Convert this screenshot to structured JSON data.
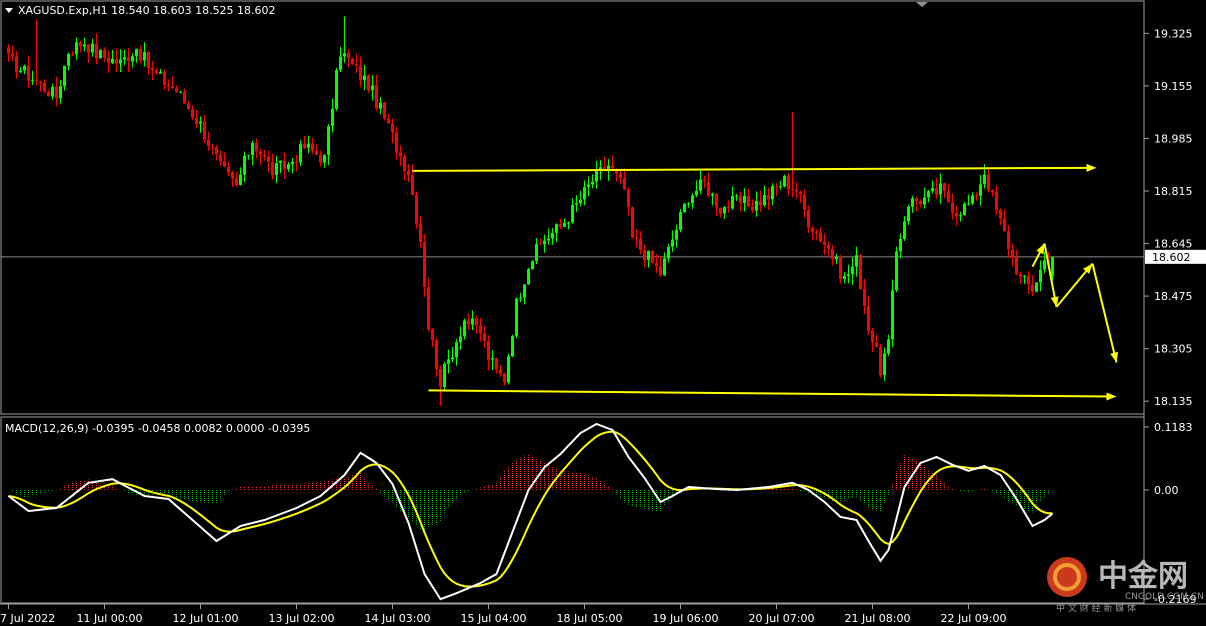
{
  "window": {
    "symbol_header": "XAGUSD.Exp,H1  18.540 18.603 18.525 18.602",
    "macd_header": "MACD(12,26,9) -0.0395 -0.0458 0.0082 0.0000 -0.0395"
  },
  "watermark": {
    "brand_cn": "中金网",
    "brand_url": "CNGOLD.COM.CN",
    "tagline_cn": "中 文 财 经 新 媒 体"
  },
  "colors": {
    "background": "#000000",
    "bull": "#00ff00",
    "bear": "#ff0000",
    "annotation": "#ffff00",
    "macd_line": "#ffffff",
    "signal_line": "#ffff00",
    "hist_pos": "#ff2a2a",
    "hist_neg": "#00b400"
  },
  "chart_data": [
    {
      "type": "candlestick",
      "symbol": "XAGUSD.Exp",
      "timeframe": "H1",
      "ohlc_last": {
        "open": 18.54,
        "high": 18.603,
        "low": 18.525,
        "close": 18.602
      },
      "ylim": [
        18.1,
        19.42
      ],
      "y_ticks": [
        19.325,
        19.155,
        18.985,
        18.815,
        18.645,
        18.475,
        18.305,
        18.135
      ],
      "y_tick_labels": [
        "19.325",
        "19.155",
        "18.985",
        "18.815",
        "18.645",
        "18.475",
        "18.305",
        "18.135"
      ],
      "current_price": 18.602,
      "current_price_label": "18.602",
      "x_labels": [
        "7 Jul 2022",
        "11 Jul 00:00",
        "12 Jul 01:00",
        "13 Jul 02:00",
        "14 Jul 03:00",
        "15 Jul 04:00",
        "18 Jul 05:00",
        "19 Jul 06:00",
        "20 Jul 07:00",
        "21 Jul 08:00",
        "22 Jul 09:00"
      ],
      "x_label_bar_index": [
        0,
        24,
        48,
        72,
        96,
        120,
        144,
        168,
        192,
        216,
        240
      ],
      "bar_count": 262,
      "anchors_close": [
        [
          0,
          19.24
        ],
        [
          6,
          19.18
        ],
        [
          12,
          19.12
        ],
        [
          15,
          19.27
        ],
        [
          19,
          19.3
        ],
        [
          22,
          19.26
        ],
        [
          28,
          19.23
        ],
        [
          32,
          19.28
        ],
        [
          36,
          19.2
        ],
        [
          42,
          19.14
        ],
        [
          48,
          19.03
        ],
        [
          53,
          18.89
        ],
        [
          57,
          18.83
        ],
        [
          61,
          18.98
        ],
        [
          66,
          18.88
        ],
        [
          70,
          18.9
        ],
        [
          74,
          18.96
        ],
        [
          79,
          18.92
        ],
        [
          83,
          19.27
        ],
        [
          86,
          19.22
        ],
        [
          90,
          19.16
        ],
        [
          94,
          19.05
        ],
        [
          98,
          18.93
        ],
        [
          100,
          18.88
        ],
        [
          103,
          18.66
        ],
        [
          105,
          18.38
        ],
        [
          108,
          18.2
        ],
        [
          111,
          18.3
        ],
        [
          114,
          18.4
        ],
        [
          118,
          18.36
        ],
        [
          120,
          18.28
        ],
        [
          122,
          18.23
        ],
        [
          124,
          18.21
        ],
        [
          127,
          18.45
        ],
        [
          130,
          18.58
        ],
        [
          134,
          18.66
        ],
        [
          138,
          18.7
        ],
        [
          142,
          18.77
        ],
        [
          146,
          18.85
        ],
        [
          150,
          18.9
        ],
        [
          154,
          18.82
        ],
        [
          156,
          18.66
        ],
        [
          160,
          18.6
        ],
        [
          163,
          18.55
        ],
        [
          166,
          18.66
        ],
        [
          170,
          18.8
        ],
        [
          174,
          18.84
        ],
        [
          178,
          18.76
        ],
        [
          182,
          18.78
        ],
        [
          186,
          18.77
        ],
        [
          190,
          18.8
        ],
        [
          194,
          18.85
        ],
        [
          197,
          18.82
        ],
        [
          200,
          18.72
        ],
        [
          205,
          18.63
        ],
        [
          209,
          18.53
        ],
        [
          212,
          18.59
        ],
        [
          215,
          18.38
        ],
        [
          218,
          18.24
        ],
        [
          220,
          18.32
        ],
        [
          222,
          18.62
        ],
        [
          225,
          18.78
        ],
        [
          229,
          18.79
        ],
        [
          233,
          18.82
        ],
        [
          237,
          18.75
        ],
        [
          241,
          18.78
        ],
        [
          244,
          18.88
        ],
        [
          247,
          18.75
        ],
        [
          250,
          18.64
        ],
        [
          253,
          18.53
        ],
        [
          256,
          18.5
        ],
        [
          259,
          18.59
        ],
        [
          261,
          18.602
        ]
      ],
      "annotations": {
        "resistance_line": {
          "from": [
            101,
            18.88
          ],
          "to": [
            272,
            18.89
          ]
        },
        "support_line": {
          "from": [
            105,
            18.17
          ],
          "to": [
            277,
            18.15
          ]
        },
        "projection_path": [
          [
            256,
            18.57
          ],
          [
            259,
            18.645
          ],
          [
            262,
            18.44
          ],
          [
            271,
            18.58
          ],
          [
            277,
            18.26
          ]
        ]
      }
    },
    {
      "type": "macd",
      "title": "MACD(12,26,9)",
      "values_shown": [
        -0.0395,
        -0.0458,
        0.0082,
        0.0,
        -0.0395
      ],
      "ylim": [
        -0.185,
        0.1183
      ],
      "y_ticks": [
        0.1183,
        0.0,
        -0.2169
      ],
      "y_tick_labels": [
        "0.1183",
        "0.00",
        "-0.2169"
      ],
      "anchors_macd": [
        [
          0,
          -0.01
        ],
        [
          5,
          -0.035
        ],
        [
          12,
          -0.03
        ],
        [
          20,
          0.012
        ],
        [
          26,
          0.018
        ],
        [
          34,
          -0.01
        ],
        [
          40,
          -0.015
        ],
        [
          46,
          -0.05
        ],
        [
          52,
          -0.085
        ],
        [
          58,
          -0.06
        ],
        [
          64,
          -0.05
        ],
        [
          72,
          -0.03
        ],
        [
          78,
          -0.01
        ],
        [
          84,
          0.025
        ],
        [
          88,
          0.062
        ],
        [
          92,
          0.045
        ],
        [
          96,
          0.01
        ],
        [
          100,
          -0.055
        ],
        [
          104,
          -0.14
        ],
        [
          108,
          -0.182
        ],
        [
          112,
          -0.172
        ],
        [
          118,
          -0.155
        ],
        [
          122,
          -0.14
        ],
        [
          126,
          -0.07
        ],
        [
          130,
          0.0
        ],
        [
          134,
          0.038
        ],
        [
          138,
          0.06
        ],
        [
          143,
          0.095
        ],
        [
          147,
          0.11
        ],
        [
          151,
          0.1
        ],
        [
          155,
          0.055
        ],
        [
          159,
          0.02
        ],
        [
          163,
          -0.02
        ],
        [
          166,
          -0.01
        ],
        [
          170,
          0.005
        ],
        [
          176,
          0.002
        ],
        [
          182,
          0.0
        ],
        [
          190,
          0.005
        ],
        [
          196,
          0.012
        ],
        [
          200,
          0.0
        ],
        [
          204,
          -0.02
        ],
        [
          208,
          -0.045
        ],
        [
          212,
          -0.05
        ],
        [
          215,
          -0.085
        ],
        [
          218,
          -0.118
        ],
        [
          220,
          -0.1
        ],
        [
          224,
          0.005
        ],
        [
          228,
          0.045
        ],
        [
          232,
          0.055
        ],
        [
          236,
          0.042
        ],
        [
          240,
          0.032
        ],
        [
          244,
          0.04
        ],
        [
          248,
          0.025
        ],
        [
          252,
          -0.015
        ],
        [
          256,
          -0.06
        ],
        [
          259,
          -0.05
        ],
        [
          261,
          -0.0395
        ]
      ]
    }
  ]
}
